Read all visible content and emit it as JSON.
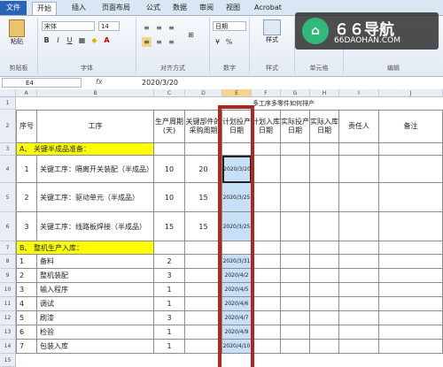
{
  "ribbon_tabs": [
    "文件",
    "开始",
    "插入",
    "页面布局",
    "公式",
    "数据",
    "审阅",
    "视图",
    "Acrobat"
  ],
  "ribbon": {
    "clipboard": {
      "label": "剪贴板",
      "paste": "粘贴"
    },
    "font": {
      "label": "字体",
      "name": "宋体",
      "size": "14",
      "bold": "B",
      "italic": "I",
      "underline": "U"
    },
    "alignment": {
      "label": "对齐方式"
    },
    "number": {
      "label": "数字",
      "format": "日期",
      "percent": "%"
    },
    "styles": {
      "label": "样式",
      "style": "样式"
    },
    "cells": {
      "label": "单元格"
    },
    "editing": {
      "label": "编辑"
    }
  },
  "formula_bar": {
    "name_box": "E4",
    "fx": "fx",
    "value": "2020/3/20"
  },
  "columns": [
    "A",
    "B",
    "C",
    "D",
    "E",
    "F",
    "G",
    "H",
    "I",
    "J"
  ],
  "rows": [
    "1",
    "2",
    "3",
    "4",
    "5",
    "6",
    "7",
    "8",
    "9",
    "10",
    "11",
    "12",
    "13",
    "14",
    "15"
  ],
  "sheet": {
    "title": "多工序多零件如何排产",
    "headers": {
      "seq": "序号",
      "process": "工序",
      "cycle": "生产周期(天)",
      "purchase": "关键部件的采购周期",
      "plan_start": "计划投产日期",
      "plan_store": "计划入库日期",
      "act_start": "实际投产日期",
      "act_store": "实际入库日期",
      "owner": "责任人",
      "remark": "备注"
    },
    "section_a": "A、 关键半成品准备：",
    "section_b": "B、 整机生产入库：",
    "key_rows": [
      {
        "no": "1",
        "name": "关键工序：隔离开关装配（半成品）",
        "cycle": "10",
        "purchase": "20",
        "date": "2020/3/20"
      },
      {
        "no": "2",
        "name": "关键工序：驱动单元（半成品）",
        "cycle": "10",
        "purchase": "15",
        "date": "2020/3/25"
      },
      {
        "no": "3",
        "name": "关键工序：线路板焊接（半成品）",
        "cycle": "15",
        "purchase": "15",
        "date": "2020/3/25"
      }
    ],
    "prod_rows": [
      {
        "no": "1",
        "name": "备料",
        "cycle": "2",
        "date": "2020/3/31"
      },
      {
        "no": "2",
        "name": "整机装配",
        "cycle": "3",
        "date": "2020/4/2"
      },
      {
        "no": "3",
        "name": "输入程序",
        "cycle": "1",
        "date": "2020/4/5"
      },
      {
        "no": "4",
        "name": "调试",
        "cycle": "1",
        "date": "2020/4/6"
      },
      {
        "no": "5",
        "name": "刷漆",
        "cycle": "3",
        "date": "2020/4/7"
      },
      {
        "no": "6",
        "name": "检验",
        "cycle": "1",
        "date": "2020/4/9"
      },
      {
        "no": "7",
        "name": "包装入库",
        "cycle": "1",
        "date": "2020/4/10"
      }
    ]
  },
  "watermark": {
    "title": "６６导航",
    "subtitle": "66DAOHAN.COM"
  }
}
